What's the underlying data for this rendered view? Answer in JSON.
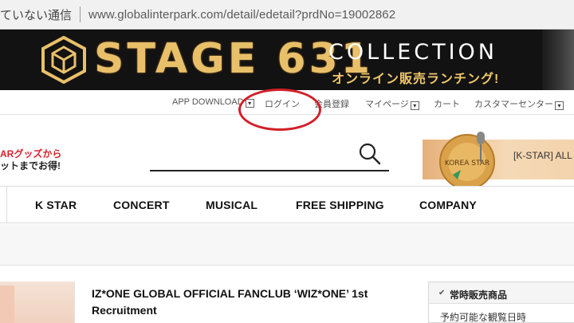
{
  "browser": {
    "security_text": "ていない通信",
    "url": "www.globalinterpark.com/detail/edetail?prdNo=19002862"
  },
  "banner": {
    "title": "STAGE 631",
    "collection": "COLLECTION",
    "subtitle": "オンライン販売ランチング!"
  },
  "util_nav": {
    "app_download": "APP DOWNLOAD",
    "login": "ログイン",
    "register": "会員登録",
    "mypage": "マイページ",
    "cart": "カート",
    "customer_center": "カスタマーセンター"
  },
  "promo": {
    "line1": "ARグッズから",
    "line2": "ットまでお得!"
  },
  "star_banner": {
    "badge_text": "KOREA STAR",
    "label": "[K-STAR] ALL A"
  },
  "main_nav": {
    "items": [
      "K STAR",
      "CONCERT",
      "MUSICAL",
      "FREE SHIPPING",
      "COMPANY"
    ]
  },
  "product": {
    "title": "IZ*ONE GLOBAL OFFICIAL FANCLUB ‘WIZ*ONE’ 1st Recruitment"
  },
  "side_panel": {
    "header": "常時販売商品",
    "row": "予約可能な観覧日時"
  },
  "colors": {
    "annotation": "#d21f28",
    "promo_red": "#d9232d",
    "banner_gold": "#e9c06a"
  }
}
